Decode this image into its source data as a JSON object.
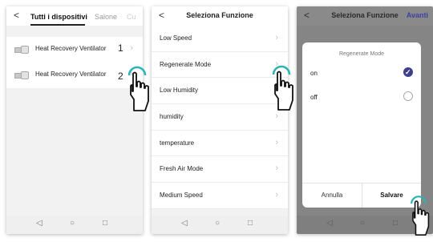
{
  "screen1": {
    "back_glyph": "<",
    "tabs": {
      "active": "Tutti i dispositivi",
      "second": "Salone",
      "third": "Cu"
    },
    "devices": [
      {
        "label": "Heat Recovery Ventilator",
        "number": "1"
      },
      {
        "label": "Heat Recovery Ventilator",
        "number": "2"
      }
    ]
  },
  "screen2": {
    "back_glyph": "<",
    "title": "Seleziona Funzione",
    "functions": [
      "Low Speed",
      "Regenerate Mode",
      "Low Humidity",
      "humidity",
      "temperature",
      "Fresh Air Mode",
      "Medium Speed"
    ]
  },
  "screen3": {
    "back_glyph": "<",
    "title": "Seleziona Funzione",
    "next_label": "Avanti",
    "dialog": {
      "title": "Regenerate Mode",
      "options": [
        {
          "label": "on",
          "selected": true
        },
        {
          "label": "off",
          "selected": false
        }
      ],
      "cancel_label": "Annulla",
      "save_label": "Salvare"
    }
  },
  "navbar": {
    "back": "◁",
    "home": "○",
    "recent": "□"
  },
  "icons": {
    "device": "hrv-device-icon",
    "chevron": "chevron-right-icon",
    "hand": "tap-hand-icon",
    "check": "check-icon"
  },
  "colors": {
    "accent": "#3f3e8c",
    "link": "#3f3ea8",
    "overlay": "#858585"
  }
}
